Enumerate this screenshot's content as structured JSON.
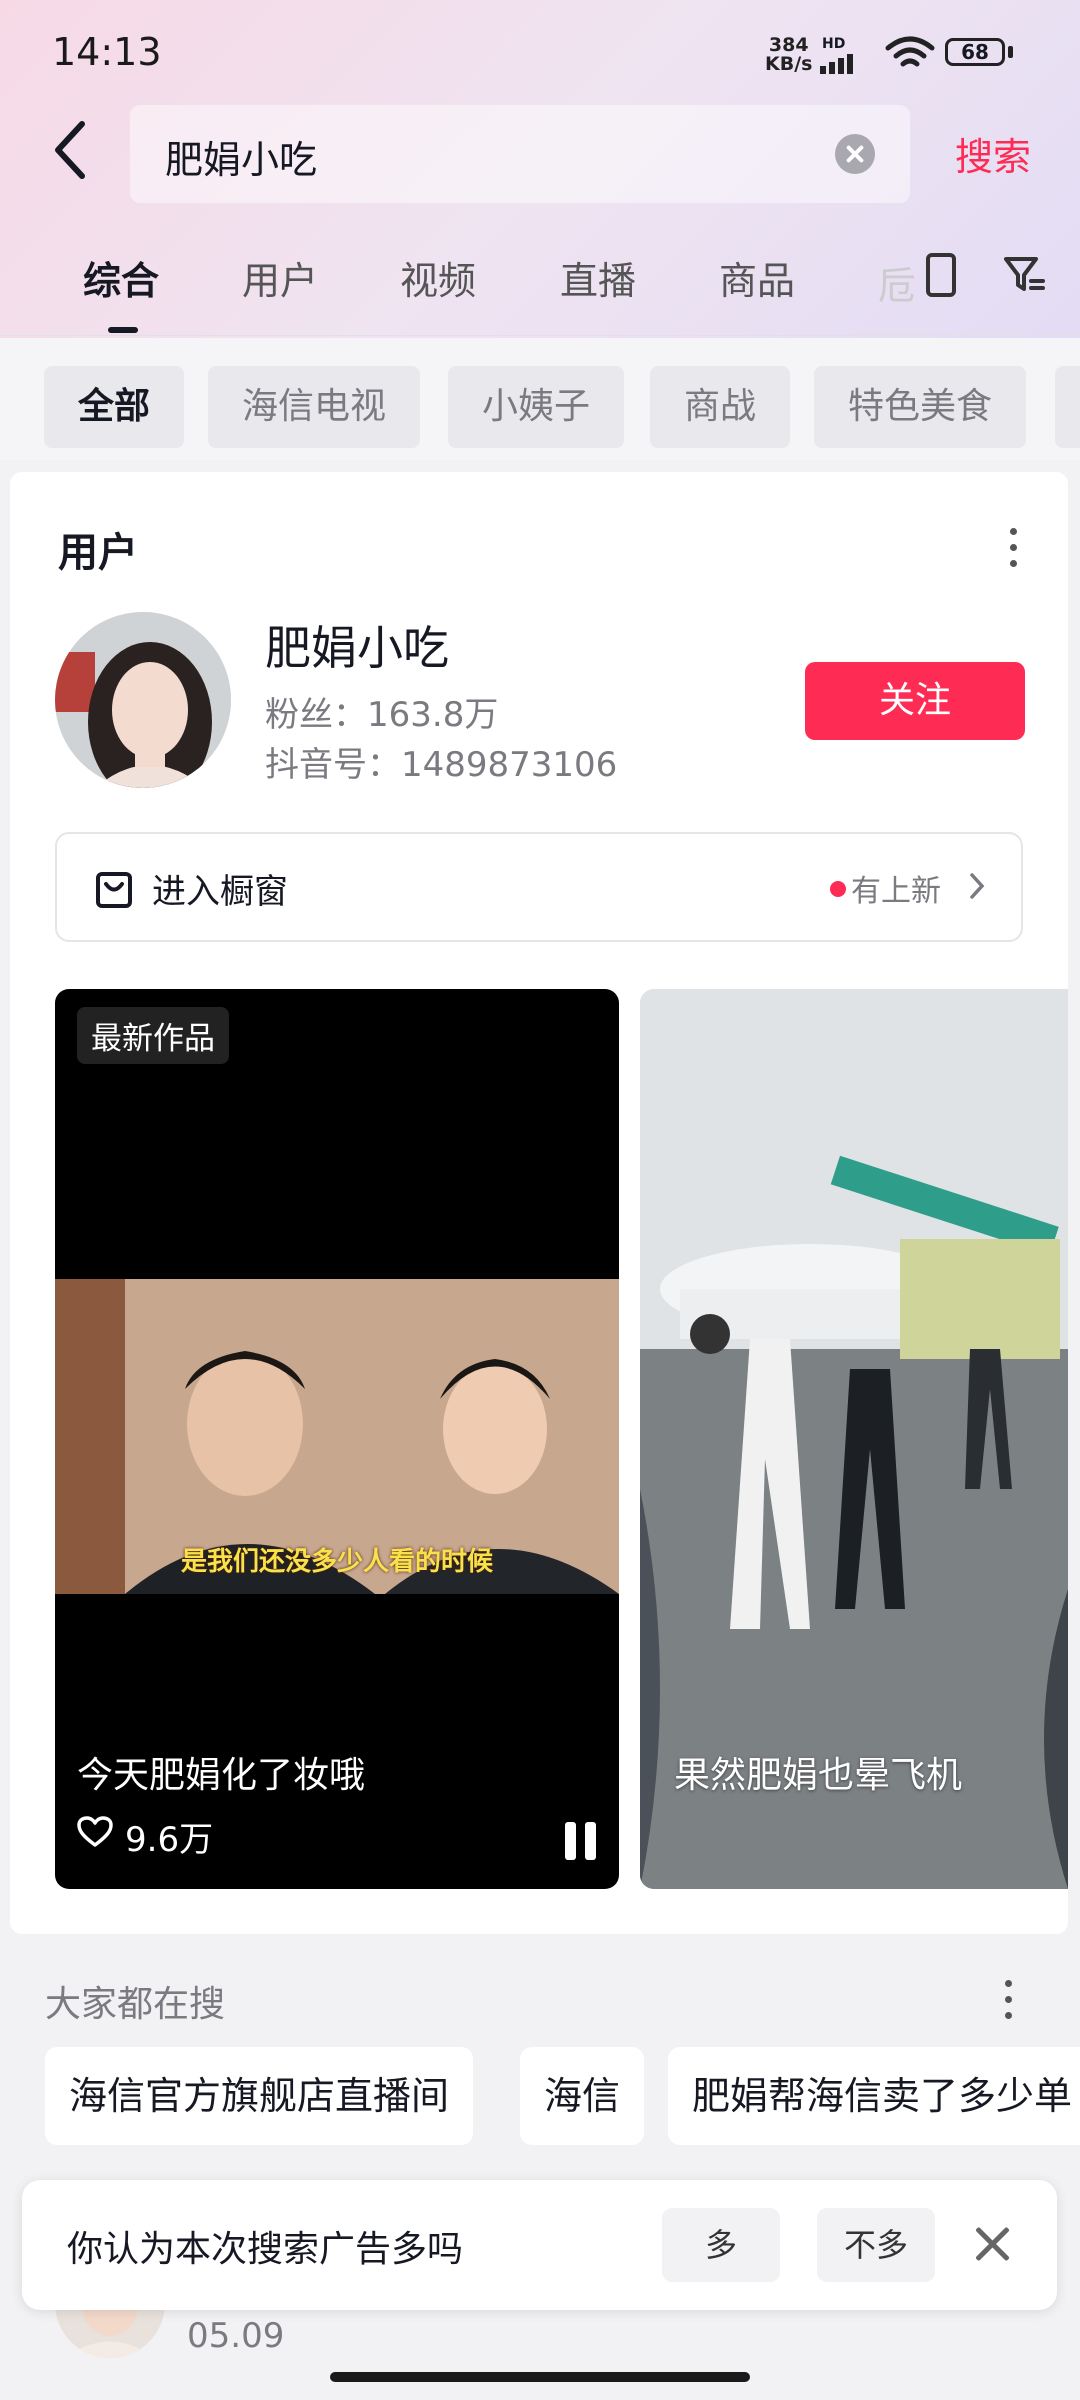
{
  "status_bar": {
    "time": "14:13",
    "net_speed_value": "384",
    "net_speed_unit": "KB/s",
    "network_label": "HD",
    "battery": "68"
  },
  "search": {
    "query": "肥娟小吃",
    "submit_label": "搜索"
  },
  "tabs": {
    "items": [
      "综合",
      "用户",
      "视频",
      "直播",
      "商品"
    ],
    "active": "综合",
    "overflow_fragment": "卮"
  },
  "chips": {
    "items": [
      "全部",
      "海信电视",
      "小姨子",
      "商战",
      "特色美食"
    ],
    "active": "全部"
  },
  "user_section": {
    "title": "用户",
    "name": "肥娟小吃",
    "fans": "粉丝：163.8万",
    "douyin_id": "抖音号：1489873106",
    "follow_label": "关注",
    "shop_label": "进入橱窗",
    "shop_status": "有上新"
  },
  "videos": [
    {
      "badge": "最新作品",
      "subtitle": "是我们还没多少人看的时候",
      "caption": "今天肥娟化了妆哦",
      "likes": "9.6万"
    },
    {
      "caption": "果然肥娟也晕飞机"
    }
  ],
  "trending": {
    "title": "大家都在搜",
    "items": [
      "海信官方旗舰店直播间",
      "海信",
      "肥娟帮海信卖了多少单"
    ]
  },
  "ad_survey": {
    "question": "你认为本次搜索广告多吗",
    "option_yes": "多",
    "option_no": "不多"
  },
  "peek_item": {
    "date": "05.09"
  },
  "colors": {
    "accent": "#fe2c55",
    "text_primary": "#161823",
    "text_secondary": "#7a7a80"
  }
}
